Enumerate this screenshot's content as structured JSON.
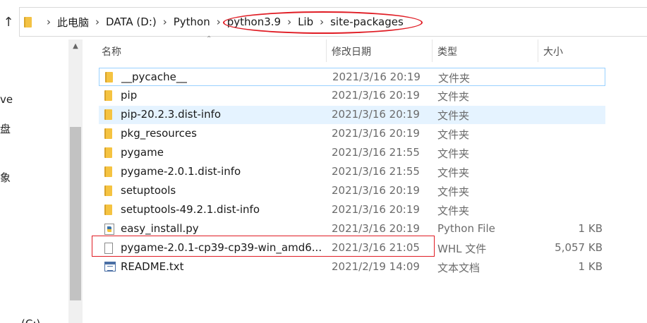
{
  "breadcrumb": [
    "此电脑",
    "DATA (D:)",
    "Python",
    "python3.9",
    "Lib",
    "site-packages"
  ],
  "left_panel": {
    "items": [
      "ve",
      "盘",
      "象",
      "(C:)"
    ]
  },
  "columns": {
    "name": "名称",
    "date": "修改日期",
    "type": "类型",
    "size": "大小"
  },
  "files": [
    {
      "name": "__pycache__",
      "date": "2021/3/16 20:19",
      "type": "文件夹",
      "size": "",
      "icon": "folder-icon"
    },
    {
      "name": "pip",
      "date": "2021/3/16 20:19",
      "type": "文件夹",
      "size": "",
      "icon": "folder-icon"
    },
    {
      "name": "pip-20.2.3.dist-info",
      "date": "2021/3/16 20:19",
      "type": "文件夹",
      "size": "",
      "icon": "folder-icon"
    },
    {
      "name": "pkg_resources",
      "date": "2021/3/16 20:19",
      "type": "文件夹",
      "size": "",
      "icon": "folder-icon"
    },
    {
      "name": "pygame",
      "date": "2021/3/16 21:55",
      "type": "文件夹",
      "size": "",
      "icon": "folder-icon"
    },
    {
      "name": "pygame-2.0.1.dist-info",
      "date": "2021/3/16 21:55",
      "type": "文件夹",
      "size": "",
      "icon": "folder-icon"
    },
    {
      "name": "setuptools",
      "date": "2021/3/16 20:19",
      "type": "文件夹",
      "size": "",
      "icon": "folder-icon"
    },
    {
      "name": "setuptools-49.2.1.dist-info",
      "date": "2021/3/16 20:19",
      "type": "文件夹",
      "size": "",
      "icon": "folder-icon"
    },
    {
      "name": "easy_install.py",
      "date": "2021/3/16 20:19",
      "type": "Python File",
      "size": "1 KB",
      "icon": "python-file-icon"
    },
    {
      "name": "pygame-2.0.1-cp39-cp39-win_amd6...",
      "date": "2021/3/16 21:05",
      "type": "WHL 文件",
      "size": "5,057 KB",
      "icon": "file-icon"
    },
    {
      "name": "README.txt",
      "date": "2021/2/19 14:09",
      "type": "文本文档",
      "size": "1 KB",
      "icon": "text-file-icon"
    }
  ],
  "colors": {
    "annotation": "#e01c24",
    "selection": "#e5f3ff",
    "focus_border": "#99d1ff",
    "folder": "#f5c341"
  }
}
